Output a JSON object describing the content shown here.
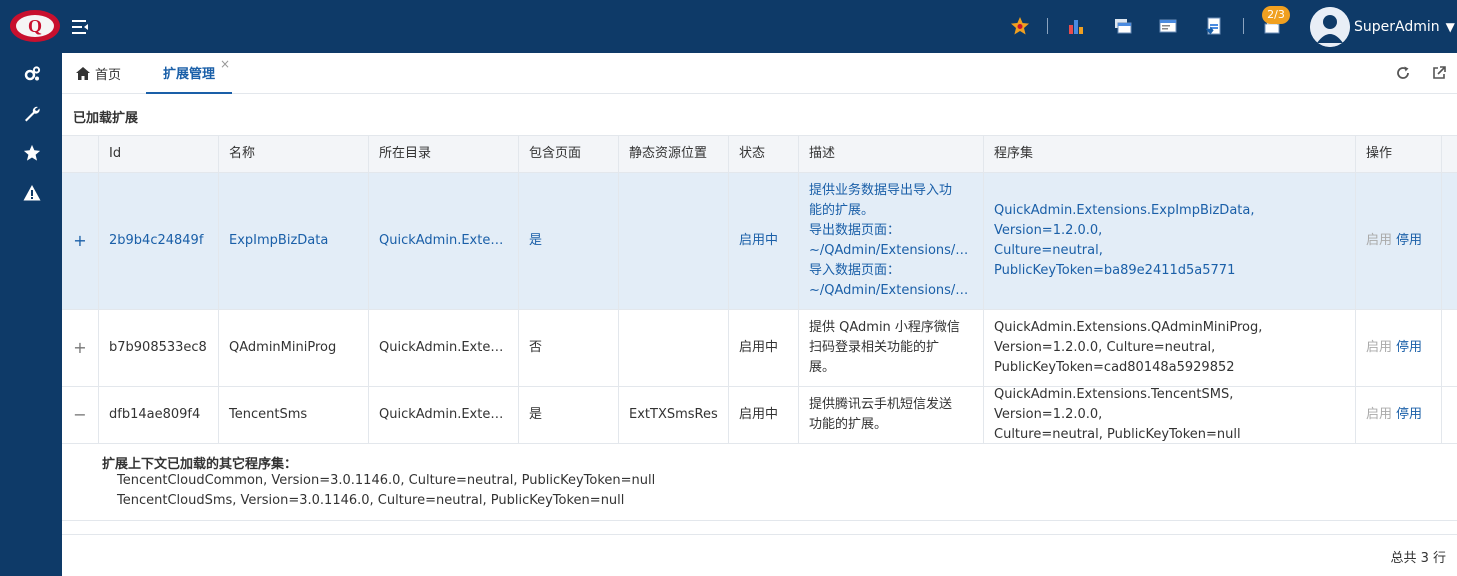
{
  "header": {
    "badge": "2/3",
    "username": "SuperAdmin"
  },
  "tabs": {
    "home": "首页",
    "current": "扩展管理",
    "close": "×"
  },
  "section_title": "已加载扩展",
  "table": {
    "columns": [
      "Id",
      "名称",
      "所在目录",
      "包含页面",
      "静态资源位置",
      "状态",
      "描述",
      "程序集",
      "操作"
    ],
    "rows": [
      {
        "expander": "+",
        "id": "2b9b4c24849f",
        "name": "ExpImpBizData",
        "dir": "QuickAdmin.Extensions.ExpImpBizData",
        "has_pages": "是",
        "static_res": "",
        "status": "启用中",
        "desc_lines": [
          "提供业务数据导出导入功",
          "能的扩展。",
          "导出数据页面：",
          "~/QAdmin/Extensions/ExpImpBizData/Export",
          "导入数据页面：",
          "~/QAdmin/Extensions/ExpImpBizData/Import"
        ],
        "assembly_lines": [
          "QuickAdmin.Extensions.ExpImpBizData, Version=1.2.0.0,",
          "Culture=neutral, PublicKeyToken=ba89e2411d5a5771"
        ],
        "op_enable": "启用",
        "op_disable": "停用"
      },
      {
        "expander": "+",
        "id": "b7b908533ec8",
        "name": "QAdminMiniProg",
        "dir": "QuickAdmin.Extensions.QAdminMiniProg",
        "has_pages": "否",
        "static_res": "",
        "status": "启用中",
        "desc_lines": [
          "提供 QAdmin 小程序微信",
          "扫码登录相关功能的扩",
          "展。"
        ],
        "assembly_lines": [
          "QuickAdmin.Extensions.QAdminMiniProg,",
          "Version=1.2.0.0, Culture=neutral,",
          "PublicKeyToken=cad80148a5929852"
        ],
        "op_enable": "启用",
        "op_disable": "停用"
      },
      {
        "expander": "−",
        "id": "dfb14ae809f4",
        "name": "TencentSms",
        "dir": "QuickAdmin.Extensions.TencentSMS",
        "has_pages": "是",
        "static_res": "ExtTXSmsRes",
        "status": "启用中",
        "desc_lines": [
          "提供腾讯云手机短信发送",
          "功能的扩展。"
        ],
        "assembly_lines": [
          "QuickAdmin.Extensions.TencentSMS, Version=1.2.0.0,",
          "Culture=neutral, PublicKeyToken=null"
        ],
        "op_enable": "启用",
        "op_disable": "停用"
      }
    ]
  },
  "extra": {
    "title": "扩展上下文已加载的其它程序集：",
    "items": [
      "TencentCloudCommon, Version=3.0.1146.0, Culture=neutral, PublicKeyToken=null",
      "TencentCloudSms, Version=3.0.1146.0, Culture=neutral, PublicKeyToken=null"
    ]
  },
  "footer": {
    "total": "总共 3 行"
  },
  "colors": {
    "nav_bg": "#0e3a68",
    "accent": "#1a5fa8",
    "selected_row": "#e3edf7",
    "badge": "#f0a020"
  }
}
